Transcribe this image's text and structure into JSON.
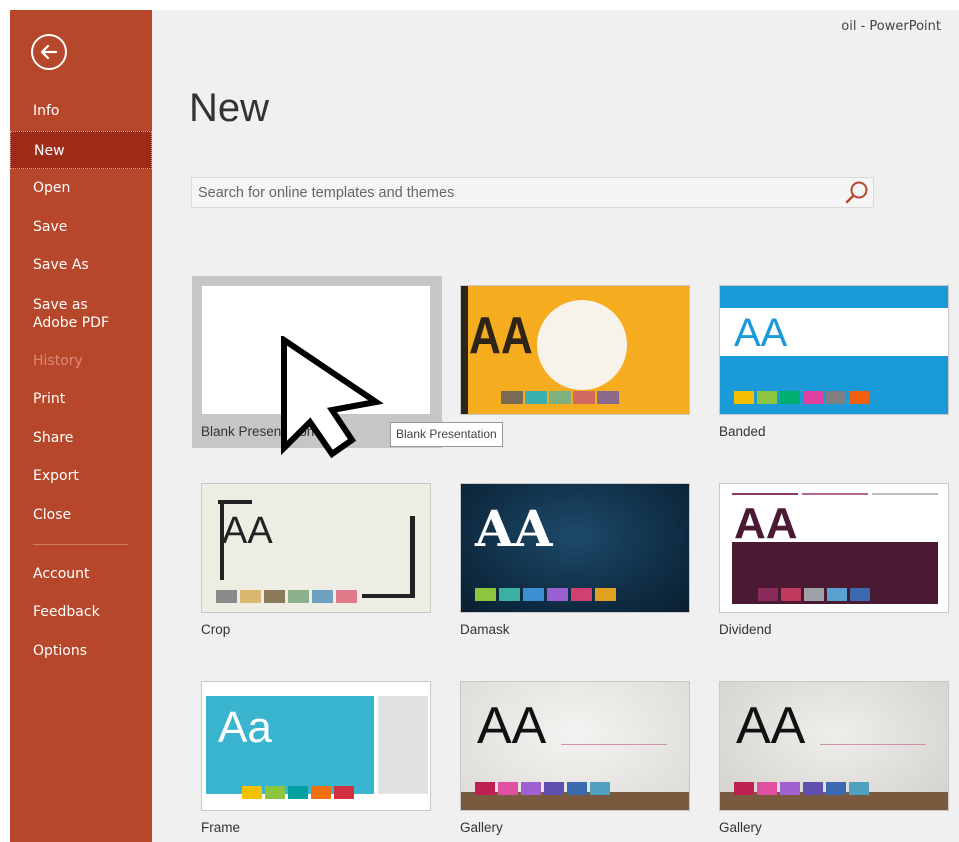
{
  "window": {
    "title": "oil  -  PowerPoint"
  },
  "sidebar": {
    "back_icon": "back-arrow-icon",
    "items": [
      {
        "label": "Info"
      },
      {
        "label": "New",
        "active": true
      },
      {
        "label": "Open"
      },
      {
        "label": "Save"
      },
      {
        "label": "Save As"
      },
      {
        "label": "Save as Adobe PDF"
      },
      {
        "label": "History",
        "disabled": true
      },
      {
        "label": "Print"
      },
      {
        "label": "Share"
      },
      {
        "label": "Export"
      },
      {
        "label": "Close"
      },
      {
        "label": "Account"
      },
      {
        "label": "Feedback"
      },
      {
        "label": "Options"
      }
    ]
  },
  "main": {
    "title": "New",
    "search": {
      "placeholder": "Search for online templates and themes",
      "icon": "search-icon"
    },
    "templates": [
      {
        "name": "Blank Presentation"
      },
      {
        "name": ""
      },
      {
        "name": "Banded"
      },
      {
        "name": "Crop"
      },
      {
        "name": "Damask"
      },
      {
        "name": "Dividend"
      },
      {
        "name": "Frame"
      },
      {
        "name": "Gallery"
      },
      {
        "name": "Gallery"
      }
    ],
    "tooltip": "Blank Presentation"
  },
  "thumb_text": {
    "aa": "AA",
    "aa_lower": "Aa"
  },
  "colors": {
    "sidebar": "#b7472a",
    "sidebar_active": "#9d2b18",
    "background": "#f0f0f0"
  }
}
